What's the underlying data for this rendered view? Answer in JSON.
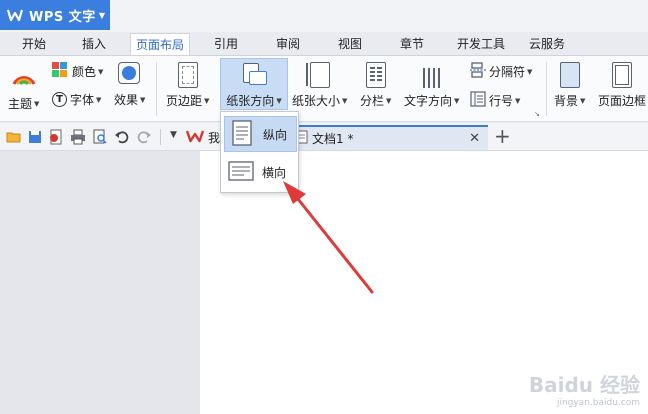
{
  "app": {
    "title": "WPS 文字",
    "brand_color": "#3a7fe0"
  },
  "tabs": [
    {
      "label": "开始"
    },
    {
      "label": "插入"
    },
    {
      "label": "页面布局",
      "active": true
    },
    {
      "label": "引用"
    },
    {
      "label": "审阅"
    },
    {
      "label": "视图"
    },
    {
      "label": "章节"
    },
    {
      "label": "开发工具"
    },
    {
      "label": "云服务"
    }
  ],
  "ribbon": {
    "theme": "主题",
    "color": "颜色",
    "font": "字体",
    "effect": "效果",
    "margins": "页边距",
    "orientation": "纸张方向",
    "size": "纸张大小",
    "columns": "分栏",
    "text_direction": "文字方向",
    "breaks": "分隔符",
    "line_numbers": "行号",
    "background": "背景",
    "page_border": "页面边框"
  },
  "doc_tabs": {
    "home": "我",
    "doc1": "文档1 *"
  },
  "orientation_menu": {
    "portrait": "纵向",
    "landscape": "横向"
  },
  "watermark": {
    "main": "Baidu 经验",
    "sub": "jingyan.baidu.com"
  },
  "annotation_color": "#e0393a"
}
